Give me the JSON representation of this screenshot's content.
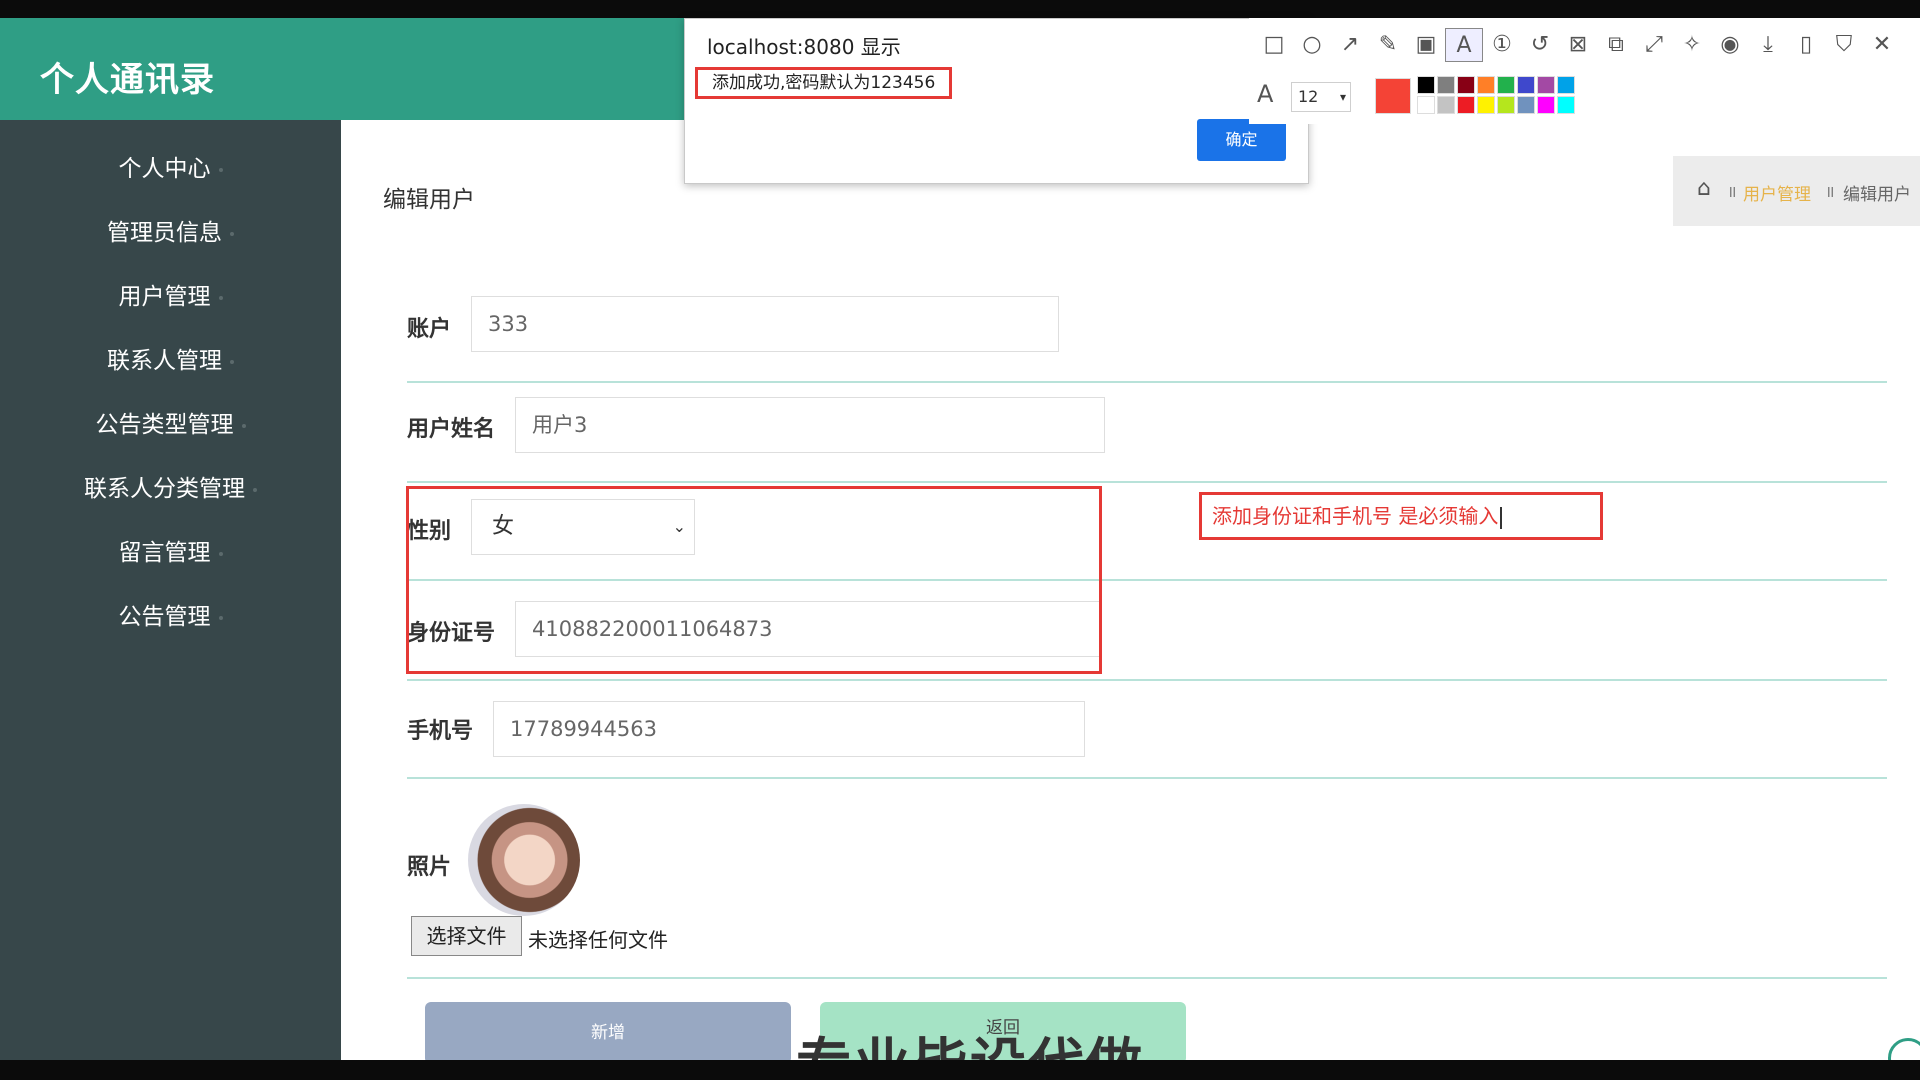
{
  "app": {
    "title": "个人通讯录"
  },
  "sidebar": {
    "items": [
      {
        "label": "个人中心"
      },
      {
        "label": "管理员信息"
      },
      {
        "label": "用户管理"
      },
      {
        "label": "联系人管理"
      },
      {
        "label": "公告类型管理"
      },
      {
        "label": "联系人分类管理"
      },
      {
        "label": "留言管理"
      },
      {
        "label": "公告管理"
      }
    ]
  },
  "main": {
    "page_title": "编辑用户",
    "breadcrumb": [
      "用户管理",
      "编辑用户"
    ],
    "form": {
      "account_label": "账户",
      "account_value": "333",
      "name_label": "用户姓名",
      "name_value": "用户3",
      "gender_label": "性别",
      "gender_value": "女",
      "idcard_label": "身份证号",
      "idcard_value": "410882200011064873",
      "phone_label": "手机号",
      "phone_value": "17789944563",
      "photo_label": "照片",
      "file_button": "选择文件",
      "file_status": "未选择任何文件"
    },
    "buttons": {
      "add": "新增",
      "back": "返回"
    },
    "watermark": "专业毕设代做"
  },
  "annotation": {
    "note": "添加身份证和手机号 是必须输入"
  },
  "dialog": {
    "title": "localhost:8080 显示",
    "message": "添加成功,密码默认为123456",
    "ok": "确定"
  },
  "toolbar": {
    "font_size": "12",
    "current_color": "#f44336",
    "swatches": [
      "#000000",
      "#7f7f7f",
      "#880015",
      "#ff7f27",
      "#22b14c",
      "#3f48cc",
      "#a349a4",
      "#00a2e8",
      "#ffffff",
      "#c3c3c3",
      "#ed1c24",
      "#fff200",
      "#b5e61d",
      "#7092be",
      "#ff00ff",
      "#00ffff"
    ]
  },
  "colors": {
    "header": "#2f9e85",
    "sidebar": "#37474a",
    "annotation": "#e53935"
  }
}
